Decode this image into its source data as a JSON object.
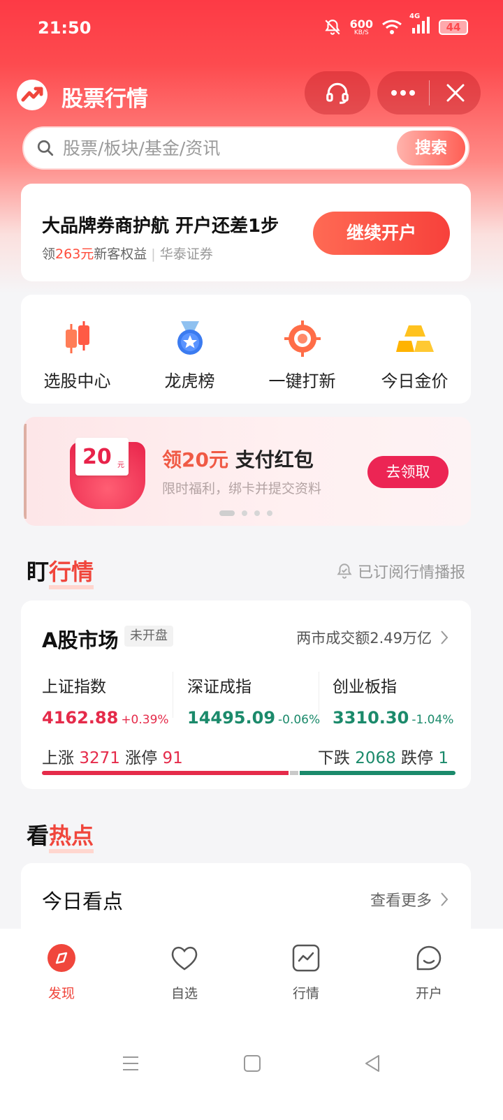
{
  "status": {
    "time": "21:50",
    "net_speed": "600",
    "net_unit": "KB/S",
    "net_type": "4G",
    "battery": "44"
  },
  "header": {
    "title": "股票行情"
  },
  "search": {
    "placeholder": "股票/板块/基金/资讯",
    "button": "搜索"
  },
  "promo": {
    "headline": "大品牌券商护航 开户还差1步",
    "sub_prefix": "领",
    "sub_amount": "263元",
    "sub_suffix": "新客权益",
    "separator": "|",
    "broker": "华泰证券",
    "button": "继续开户"
  },
  "quick_links": [
    {
      "label": "选股中心",
      "icon": "candlestick-icon"
    },
    {
      "label": "龙虎榜",
      "icon": "medal-icon"
    },
    {
      "label": "一键打新",
      "icon": "target-icon"
    },
    {
      "label": "今日金价",
      "icon": "gold-bars-icon"
    }
  ],
  "banner": {
    "coupon_value": "20",
    "coupon_unit": "元",
    "title_red": "领20元",
    "title_black": " 支付红包",
    "subtitle": "限时福利，绑卡并提交资料",
    "button": "去领取",
    "pages": 4,
    "active_page": 1
  },
  "market_section": {
    "title_a": "盯",
    "title_b": "行情",
    "subscribe": "已订阅行情播报"
  },
  "market": {
    "title": "A股市场",
    "status": "未开盘",
    "volume": "两市成交额2.49万亿",
    "indices": [
      {
        "name": "上证指数",
        "value": "4162.88",
        "change": "+0.39%",
        "trend": "up"
      },
      {
        "name": "深证成指",
        "value": "14495.09",
        "change": "-0.06%",
        "trend": "down"
      },
      {
        "name": "创业板指",
        "value": "3310.30",
        "change": "-1.04%",
        "trend": "down"
      }
    ],
    "up_label": "上涨",
    "up_count": "3271",
    "limit_up_label": "涨停",
    "limit_up_count": "91",
    "down_label": "下跌",
    "down_count": "2068",
    "limit_down_label": "跌停",
    "limit_down_count": "1",
    "colors": {
      "up": "#e52b4a",
      "down": "#1b8a6b"
    }
  },
  "hot_section": {
    "title_a": "看",
    "title_b": "热点"
  },
  "today": {
    "title": "今日看点",
    "more": "查看更多"
  },
  "tabs": [
    {
      "label": "发现",
      "icon": "compass-icon",
      "active": true
    },
    {
      "label": "自选",
      "icon": "heart-icon",
      "active": false
    },
    {
      "label": "行情",
      "icon": "chart-icon",
      "active": false
    },
    {
      "label": "开户",
      "icon": "smile-icon",
      "active": false
    }
  ]
}
